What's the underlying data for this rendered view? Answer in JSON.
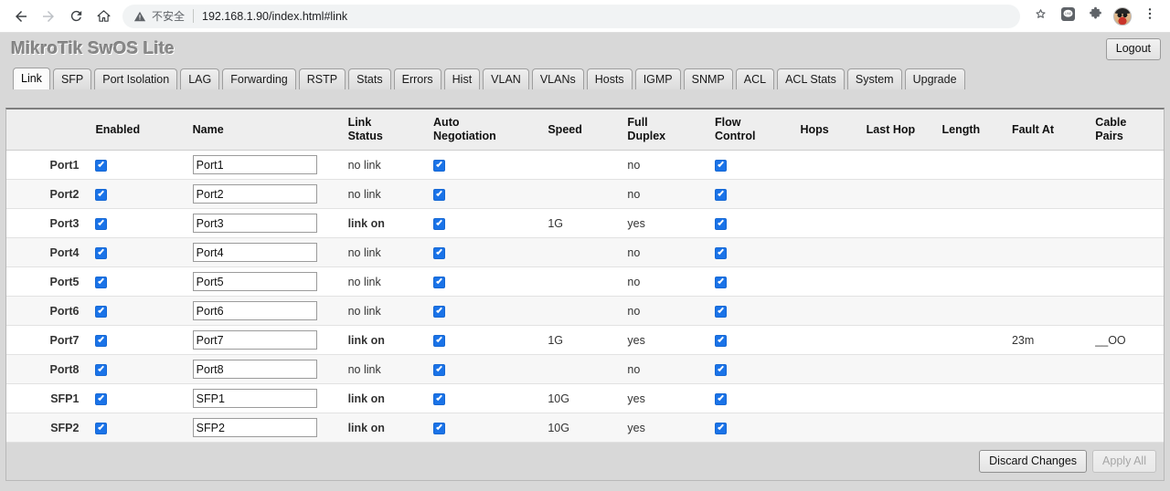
{
  "browser": {
    "back_icon": "back-arrow-icon",
    "forward_icon": "forward-arrow-icon",
    "reload_icon": "reload-icon",
    "home_icon": "home-icon",
    "security_warning": "不安全",
    "url": "192.168.1.90/index.html#link",
    "bookmark_icon": "star-icon",
    "line_extension_icon": "line-extension-icon",
    "extensions_icon": "puzzle-piece-icon",
    "avatar_icon": "profile-avatar",
    "menu_icon": "three-dot-menu-icon"
  },
  "app": {
    "brand": "MikroTik SwOS Lite",
    "logout_label": "Logout",
    "accent_color": "#1a73e8",
    "header_bg": "#d8d8d8"
  },
  "tabs": [
    {
      "label": "Link",
      "active": true
    },
    {
      "label": "SFP",
      "active": false
    },
    {
      "label": "Port Isolation",
      "active": false
    },
    {
      "label": "LAG",
      "active": false
    },
    {
      "label": "Forwarding",
      "active": false
    },
    {
      "label": "RSTP",
      "active": false
    },
    {
      "label": "Stats",
      "active": false
    },
    {
      "label": "Errors",
      "active": false
    },
    {
      "label": "Hist",
      "active": false
    },
    {
      "label": "VLAN",
      "active": false
    },
    {
      "label": "VLANs",
      "active": false
    },
    {
      "label": "Hosts",
      "active": false
    },
    {
      "label": "IGMP",
      "active": false
    },
    {
      "label": "SNMP",
      "active": false
    },
    {
      "label": "ACL",
      "active": false
    },
    {
      "label": "ACL Stats",
      "active": false
    },
    {
      "label": "System",
      "active": false
    },
    {
      "label": "Upgrade",
      "active": false
    }
  ],
  "table": {
    "headers": {
      "port": "",
      "enabled": "Enabled",
      "name": "Name",
      "link_status": "Link\nStatus",
      "link_status_l1": "Link",
      "link_status_l2": "Status",
      "auto_negotiation_l1": "Auto",
      "auto_negotiation_l2": "Negotiation",
      "speed": "Speed",
      "full_duplex_l1": "Full",
      "full_duplex_l2": "Duplex",
      "flow_control_l1": "Flow",
      "flow_control_l2": "Control",
      "hops": "Hops",
      "last_hop": "Last Hop",
      "length": "Length",
      "fault_at": "Fault At",
      "cable_pairs_l1": "Cable",
      "cable_pairs_l2": "Pairs"
    },
    "rows": [
      {
        "port": "Port1",
        "enabled": true,
        "name": "Port1",
        "link_status": "no link",
        "link_up": false,
        "auto_negotiation": true,
        "speed": "",
        "full_duplex": "no",
        "flow_control": true,
        "hops": "",
        "last_hop": "",
        "length": "",
        "fault_at": "",
        "cable_pairs": ""
      },
      {
        "port": "Port2",
        "enabled": true,
        "name": "Port2",
        "link_status": "no link",
        "link_up": false,
        "auto_negotiation": true,
        "speed": "",
        "full_duplex": "no",
        "flow_control": true,
        "hops": "",
        "last_hop": "",
        "length": "",
        "fault_at": "",
        "cable_pairs": ""
      },
      {
        "port": "Port3",
        "enabled": true,
        "name": "Port3",
        "link_status": "link on",
        "link_up": true,
        "auto_negotiation": true,
        "speed": "1G",
        "full_duplex": "yes",
        "flow_control": true,
        "hops": "",
        "last_hop": "",
        "length": "",
        "fault_at": "",
        "cable_pairs": ""
      },
      {
        "port": "Port4",
        "enabled": true,
        "name": "Port4",
        "link_status": "no link",
        "link_up": false,
        "auto_negotiation": true,
        "speed": "",
        "full_duplex": "no",
        "flow_control": true,
        "hops": "",
        "last_hop": "",
        "length": "",
        "fault_at": "",
        "cable_pairs": ""
      },
      {
        "port": "Port5",
        "enabled": true,
        "name": "Port5",
        "link_status": "no link",
        "link_up": false,
        "auto_negotiation": true,
        "speed": "",
        "full_duplex": "no",
        "flow_control": true,
        "hops": "",
        "last_hop": "",
        "length": "",
        "fault_at": "",
        "cable_pairs": ""
      },
      {
        "port": "Port6",
        "enabled": true,
        "name": "Port6",
        "link_status": "no link",
        "link_up": false,
        "auto_negotiation": true,
        "speed": "",
        "full_duplex": "no",
        "flow_control": true,
        "hops": "",
        "last_hop": "",
        "length": "",
        "fault_at": "",
        "cable_pairs": ""
      },
      {
        "port": "Port7",
        "enabled": true,
        "name": "Port7",
        "link_status": "link on",
        "link_up": true,
        "auto_negotiation": true,
        "speed": "1G",
        "full_duplex": "yes",
        "flow_control": true,
        "hops": "",
        "last_hop": "",
        "length": "",
        "fault_at": "23m",
        "cable_pairs": "__OO"
      },
      {
        "port": "Port8",
        "enabled": true,
        "name": "Port8",
        "link_status": "no link",
        "link_up": false,
        "auto_negotiation": true,
        "speed": "",
        "full_duplex": "no",
        "flow_control": true,
        "hops": "",
        "last_hop": "",
        "length": "",
        "fault_at": "",
        "cable_pairs": ""
      },
      {
        "port": "SFP1",
        "enabled": true,
        "name": "SFP1",
        "link_status": "link on",
        "link_up": true,
        "auto_negotiation": true,
        "speed": "10G",
        "full_duplex": "yes",
        "flow_control": true,
        "hops": "",
        "last_hop": "",
        "length": "",
        "fault_at": "",
        "cable_pairs": ""
      },
      {
        "port": "SFP2",
        "enabled": true,
        "name": "SFP2",
        "link_status": "link on",
        "link_up": true,
        "auto_negotiation": true,
        "speed": "10G",
        "full_duplex": "yes",
        "flow_control": true,
        "hops": "",
        "last_hop": "",
        "length": "",
        "fault_at": "",
        "cable_pairs": ""
      }
    ]
  },
  "footer": {
    "discard_label": "Discard Changes",
    "discard_enabled": true,
    "apply_label": "Apply All",
    "apply_enabled": false
  }
}
